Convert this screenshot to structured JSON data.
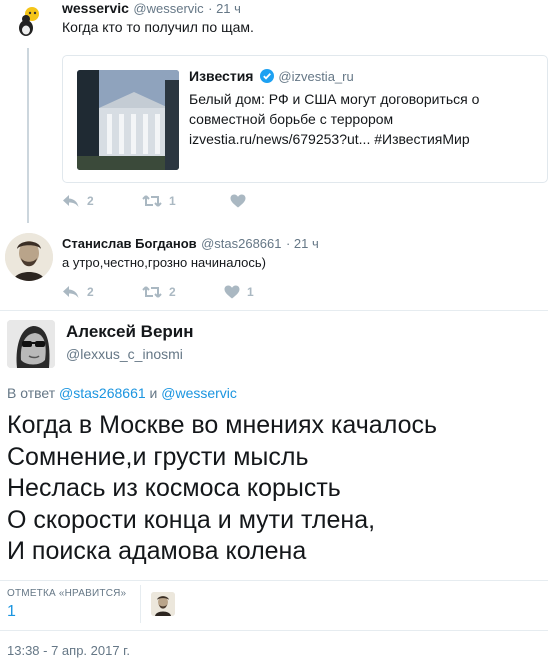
{
  "thread": [
    {
      "name": "wesservic",
      "handle": "@wesservic",
      "time": "· 21 ч",
      "text": "Когда кто то получил по щам.",
      "quoted": {
        "name": "Известия",
        "handle": "@izvestia_ru",
        "line1": "Белый дом: РФ и США могут договориться о",
        "line2": "совместной борьбе с террором",
        "line3": "izvestia.ru/news/679253?ut... #ИзвестияМир"
      },
      "reply_count": "2",
      "retweet_count": "1",
      "like_count": ""
    },
    {
      "name": "Станислав Богданов",
      "handle": "@stas268661",
      "time": "· 21 ч",
      "text": "а утро,честно,грозно начиналось)",
      "reply_count": "2",
      "retweet_count": "2",
      "like_count": "1"
    }
  ],
  "main": {
    "name": "Алексей Верин",
    "handle": "@lexxus_c_inosmi",
    "reply_prefix": "В ответ",
    "reply_to_1": "@stas268661",
    "reply_and": "и",
    "reply_to_2": "@wesservic",
    "lines": [
      "Когда в Москве во мнениях качалось",
      "Сомнение,и грусти мысль",
      "Неслась из космоса корысть",
      "О скорости конца и мути тлена,",
      "И поиска адамова колена"
    ],
    "likes_label": "ОТМЕТКА «НРАВИТСЯ»",
    "likes_count": "1",
    "timestamp": "13:38 - 7 апр. 2017 г."
  },
  "colors": {
    "link": "#1b95e0",
    "verified": "#1da1f2",
    "action_gray": "#aab8c2",
    "secondary": "#657786"
  }
}
